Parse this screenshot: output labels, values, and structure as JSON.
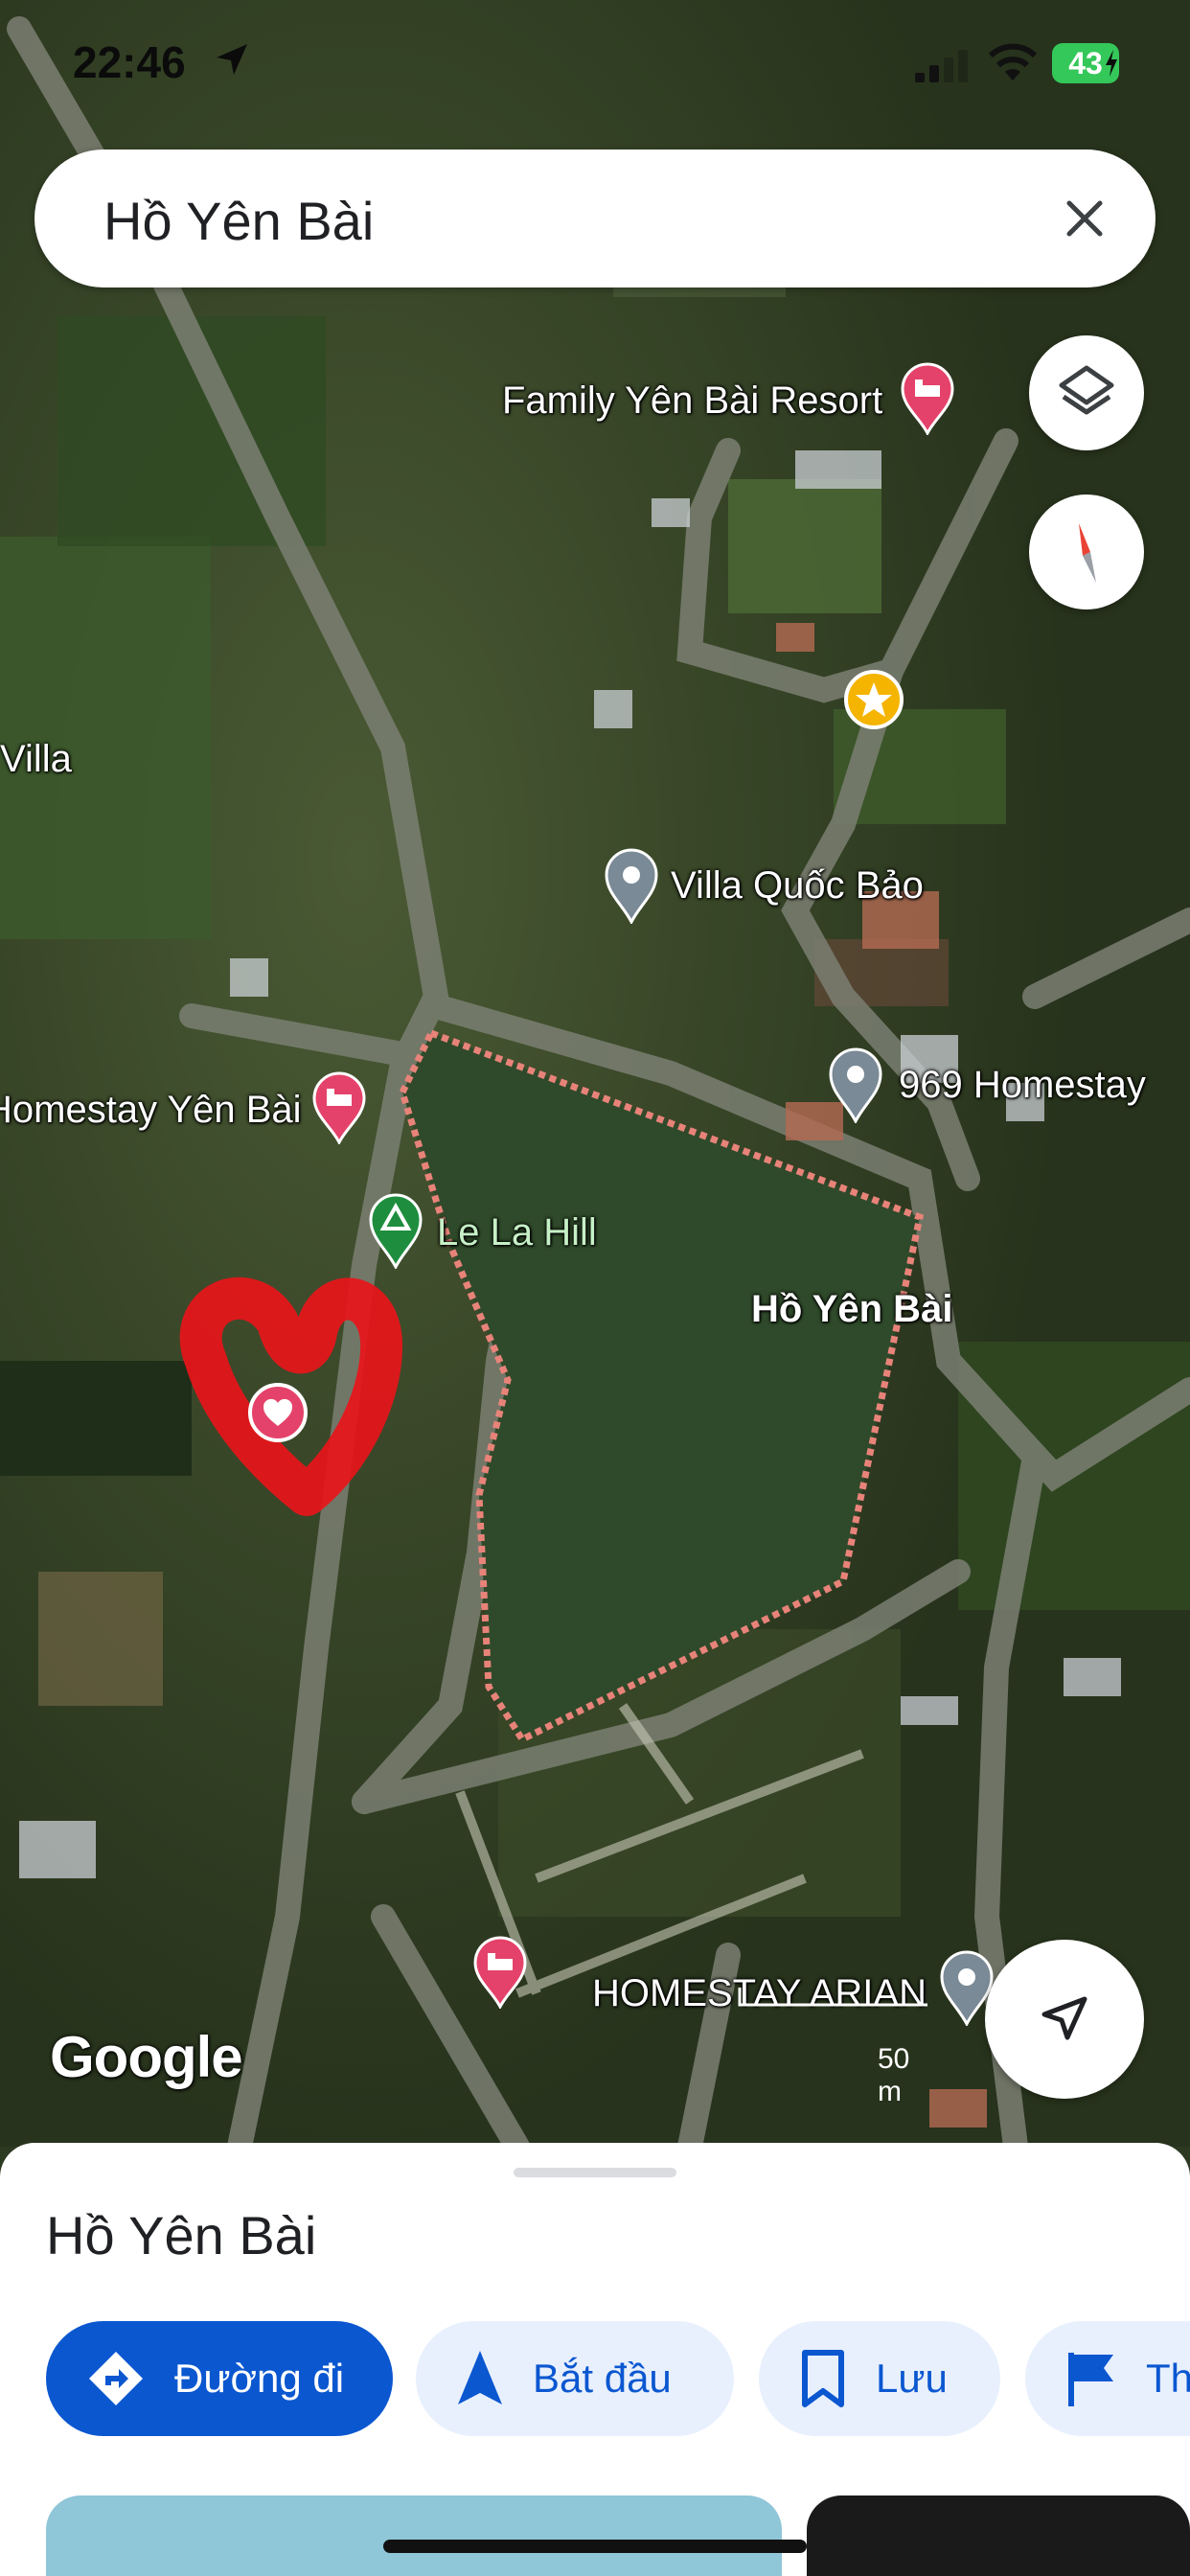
{
  "status_bar": {
    "time": "22:46",
    "battery": "43"
  },
  "search": {
    "query": "Hồ Yên Bài"
  },
  "map": {
    "labels": {
      "family_resort": "Family Yên Bài Resort",
      "villa_left": "Villa",
      "villa_quoc_bao": "Villa Quốc Bảo",
      "homestay_969": "969 Homestay",
      "homestay_yen_bai": "Homestay Yên Bài",
      "le_la_hill": "Le La Hill",
      "lake": "Hồ Yên Bài",
      "homestay_arian": "HOMESTAY ARIAN"
    },
    "attribution": "Google",
    "scale": "50 m"
  },
  "place_sheet": {
    "title": "Hồ Yên Bài",
    "actions": [
      {
        "label": "Đường đi"
      },
      {
        "label": "Bắt đầu"
      },
      {
        "label": "Lưu"
      },
      {
        "label": "Th"
      }
    ]
  },
  "colors": {
    "accent": "#0b57d0",
    "chip_bg": "#e8f0fe",
    "lake_outline": "#e8837a",
    "hotel_pin": "#e4426a",
    "campground_pin": "#1e8e3e"
  }
}
